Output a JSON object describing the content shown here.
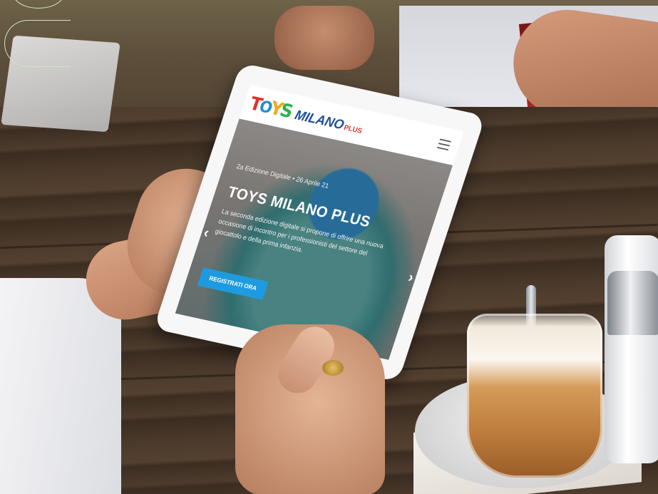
{
  "site": {
    "logo": {
      "t": "T",
      "o": "O",
      "y": "Y",
      "s": "S",
      "milano": "MILANO",
      "plus": "PLUS"
    },
    "menu_icon": "hamburger-icon"
  },
  "hero": {
    "subtitle": "2a Edizione Digitale • 26 Aprile 21",
    "title": "TOYS MILANO PLUS",
    "description": "La seconda edizione digitale si propone di offrire una nuova occasione di incontro per i professionisti del settore del giocattolo e della prima infanzia.",
    "cta_label": "REGISTRATI ORA",
    "prev_icon": "chevron-left-icon",
    "next_icon": "chevron-right-icon"
  },
  "colors": {
    "cta": "#1e9be0",
    "logo_red": "#e0312e",
    "logo_blue": "#1c4f9c",
    "logo_yellow": "#f2a81d",
    "logo_green": "#2bb24c"
  }
}
